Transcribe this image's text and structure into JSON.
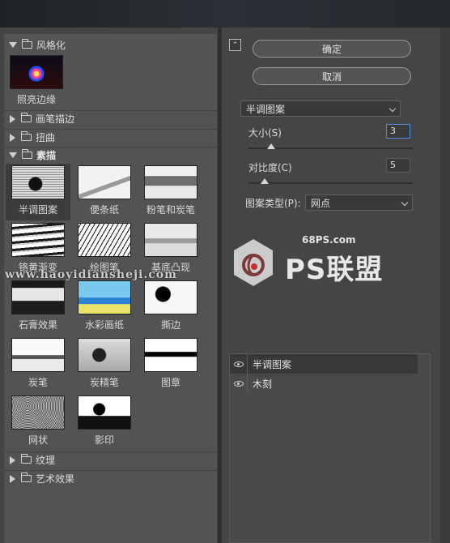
{
  "categories": {
    "stylize": {
      "label": "风格化",
      "thumb": {
        "label": "照亮边缘"
      }
    },
    "brush_strokes": {
      "label": "画笔描边"
    },
    "distort": {
      "label": "扭曲"
    },
    "sketch": {
      "label": "素描"
    },
    "texture": {
      "label": "纹理"
    },
    "artistic": {
      "label": "艺术效果"
    }
  },
  "sketch_thumbs": [
    {
      "label": "半调图案",
      "icon": "halftone-thumb"
    },
    {
      "label": "便条纸",
      "icon": "note-paper-thumb"
    },
    {
      "label": "粉笔和炭笔",
      "icon": "chalk-charcoal-thumb"
    },
    {
      "label": "铬黄渐变",
      "icon": "chrome-thumb"
    },
    {
      "label": "绘图笔",
      "icon": "graphic-pen-thumb"
    },
    {
      "label": "基底凸现",
      "icon": "bas-relief-thumb"
    },
    {
      "label": "石膏效果",
      "icon": "plaster-thumb"
    },
    {
      "label": "水彩画纸",
      "icon": "water-paper-thumb"
    },
    {
      "label": "撕边",
      "icon": "torn-edges-thumb"
    },
    {
      "label": "炭笔",
      "icon": "charcoal-thumb"
    },
    {
      "label": "炭精笔",
      "icon": "conte-crayon-thumb"
    },
    {
      "label": "图章",
      "icon": "stamp-thumb"
    },
    {
      "label": "网状",
      "icon": "reticulation-thumb"
    },
    {
      "label": "影印",
      "icon": "photocopy-thumb"
    }
  ],
  "buttons": {
    "ok": "确定",
    "cancel": "取消"
  },
  "filter_select": {
    "value": "半调图案"
  },
  "params": {
    "size": {
      "label": "大小(S)",
      "value": "3",
      "level": 0.14
    },
    "contrast": {
      "label": "对比度(C)",
      "value": "5",
      "level": 0.1
    },
    "pattern_type": {
      "label": "图案类型(P):",
      "value": "网点"
    }
  },
  "layers": [
    {
      "name": "半调图案",
      "active": true
    },
    {
      "name": "木刻",
      "active": false
    }
  ],
  "watermark": {
    "url": "www.haoyidiansheji.com",
    "site": "68PS.com",
    "brand": "PS联盟"
  },
  "colors": {
    "panel": "#535353",
    "frame": "#454545",
    "focus": "#4f8ede"
  }
}
